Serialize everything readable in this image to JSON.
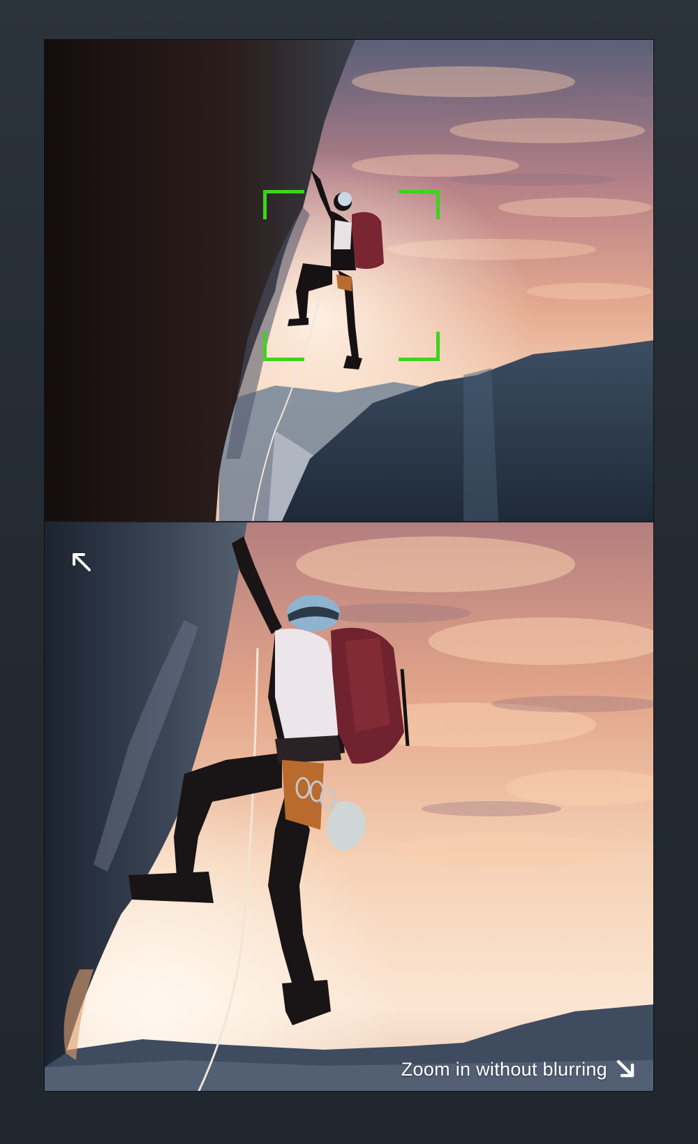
{
  "caption": {
    "text": "Zoom in without blurring",
    "icon": "arrow-down-right-icon"
  },
  "top_panel": {
    "subject": "rock climber at sunset",
    "marker_color": "#3dd41c"
  },
  "bottom_panel": {
    "subject": "zoomed rock climber",
    "corner_icon": "arrow-up-left-icon"
  },
  "colors": {
    "background": "#252c33",
    "marker": "#3dd41c",
    "caption_text": "#ffffff"
  }
}
